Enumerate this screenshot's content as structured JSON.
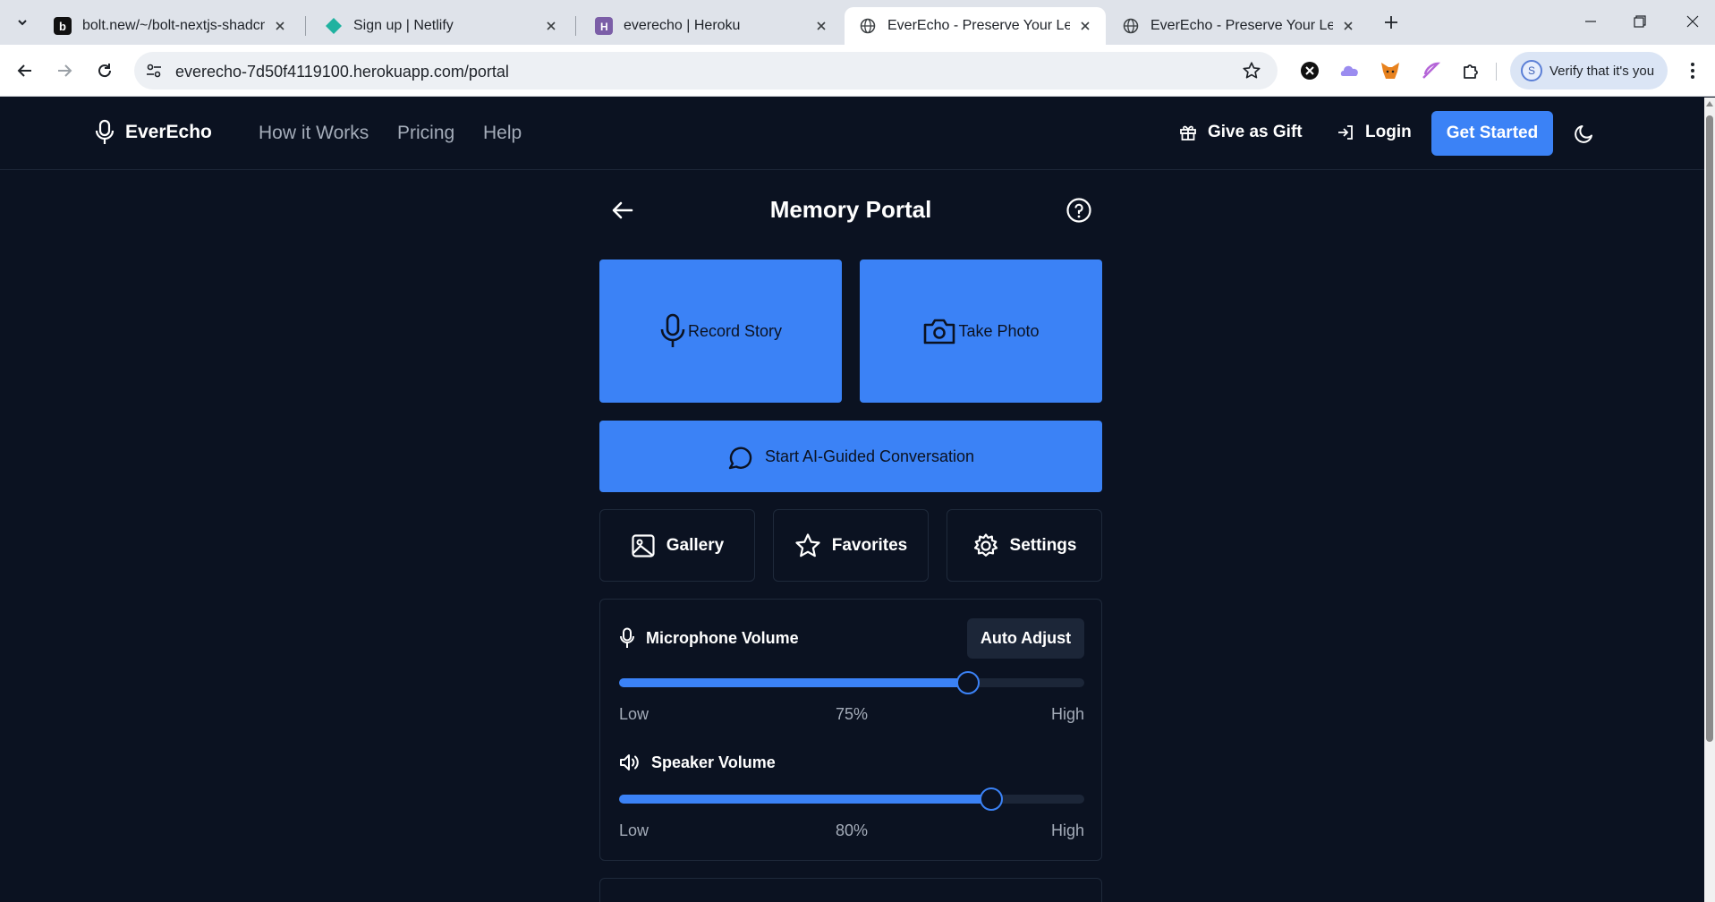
{
  "browser": {
    "tabs": [
      {
        "title": "bolt.new/~/bolt-nextjs-shadcn-",
        "icon": "bolt-favicon",
        "active": false
      },
      {
        "title": "Sign up | Netlify",
        "icon": "netlify-favicon",
        "active": false
      },
      {
        "title": "everecho | Heroku",
        "icon": "heroku-favicon",
        "active": false
      },
      {
        "title": "EverEcho - Preserve Your Legacy",
        "icon": "globe-favicon",
        "active": true
      },
      {
        "title": "EverEcho - Preserve Your Legacy",
        "icon": "globe-favicon",
        "active": false
      }
    ],
    "url": "everecho-7d50f4119100.herokuapp.com/portal",
    "profile_button": "Verify that it's you",
    "profile_initial": "S"
  },
  "header": {
    "brand": "EverEcho",
    "nav": [
      "How it Works",
      "Pricing",
      "Help"
    ],
    "gift": "Give as Gift",
    "login": "Login",
    "cta": "Get Started"
  },
  "portal": {
    "title": "Memory Portal",
    "record": "Record Story",
    "photo": "Take Photo",
    "ai": "Start AI-Guided Conversation",
    "gallery": "Gallery",
    "favorites": "Favorites",
    "settings": "Settings"
  },
  "volume": {
    "auto_adjust": "Auto Adjust",
    "mic": {
      "label": "Microphone Volume",
      "value": 75,
      "display": "75%",
      "low": "Low",
      "high": "High"
    },
    "speaker": {
      "label": "Speaker Volume",
      "value": 80,
      "display": "80%",
      "low": "Low",
      "high": "High"
    }
  },
  "colors": {
    "background": "#0b1221",
    "accent": "#3b82f6",
    "muted_text": "#a4acb9",
    "card_border": "#1f2a3b"
  }
}
